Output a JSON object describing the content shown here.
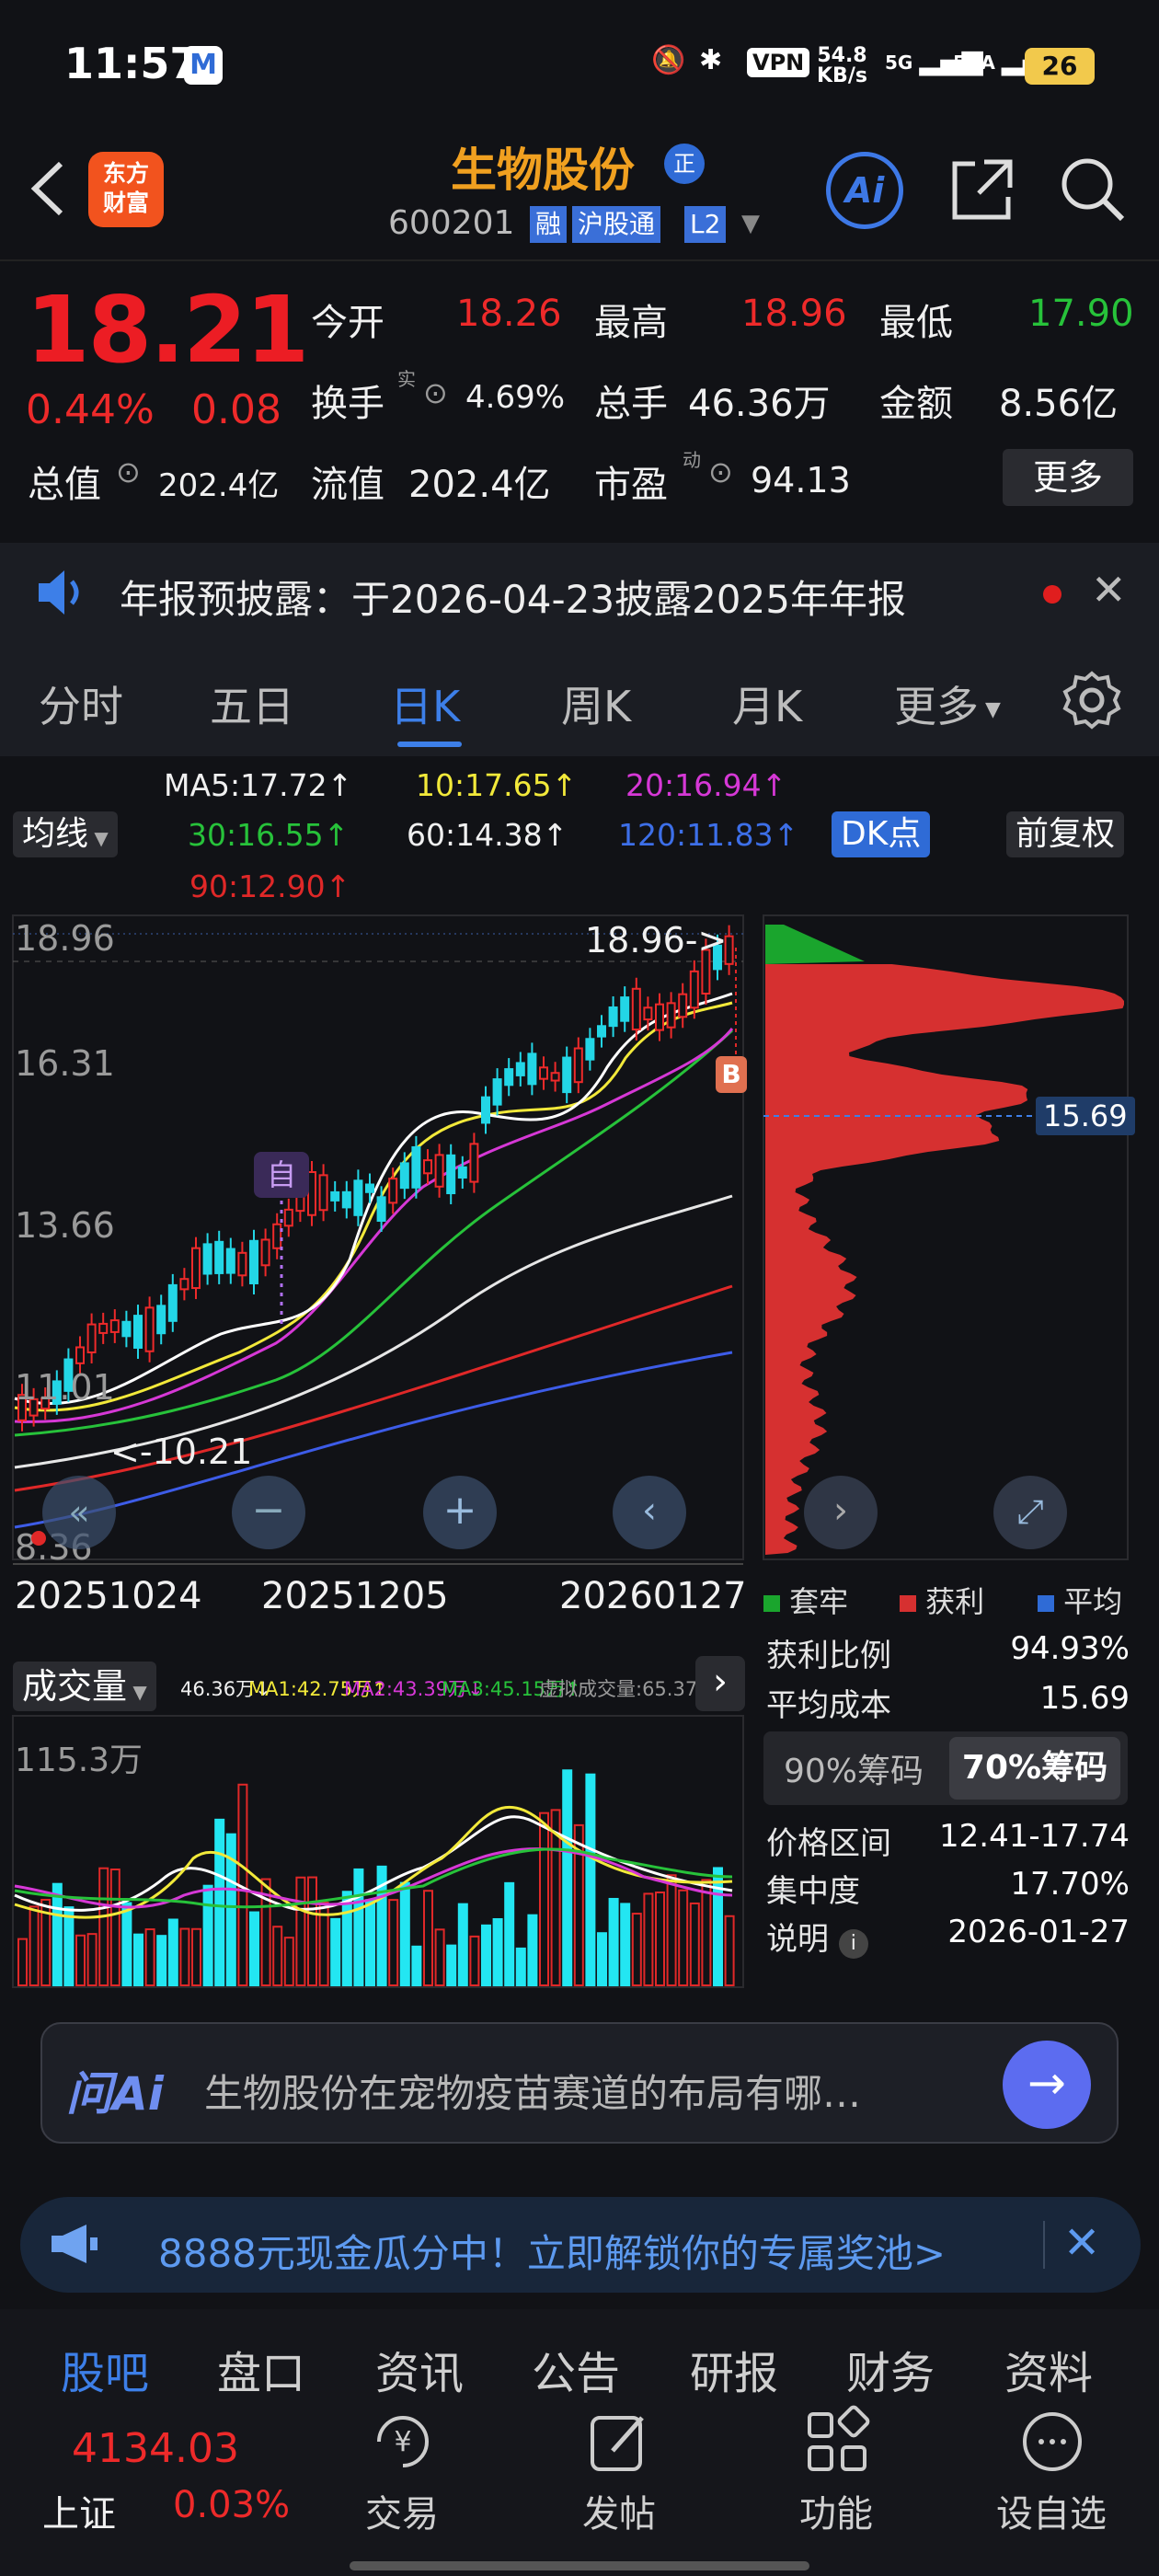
{
  "status_bar": {
    "time": "11:57",
    "net_speed": "54.8",
    "net_unit": "KB/s",
    "sig1": "5G",
    "sig2": "5GA",
    "battery": "26",
    "vpn": "VPN"
  },
  "header": {
    "logo_line1": "东方",
    "logo_line2": "财富",
    "stock_name": "生物股份",
    "badge": "正",
    "code": "600201",
    "tags": [
      "融",
      "沪股通",
      "L2"
    ],
    "ai_label": "Ai"
  },
  "quote": {
    "price": "18.21",
    "pct": "0.44%",
    "chg": "0.08",
    "open_label": "今开",
    "open": "18.26",
    "high_label": "最高",
    "high": "18.96",
    "low_label": "最低",
    "low": "17.90",
    "turnover_label": "换手",
    "turnover_sup": "实",
    "turnover": "4.69%",
    "vol_label": "总手",
    "vol": "46.36万",
    "amount_label": "金额",
    "amount": "8.56亿",
    "mcap_label": "总值",
    "mcap": "202.4亿",
    "float_label": "流值",
    "float": "202.4亿",
    "pe_label": "市盈",
    "pe_sup": "动",
    "pe": "94.13",
    "more": "更多"
  },
  "notice": {
    "text": "年报预披露：于2026-04-23披露2025年年报"
  },
  "tabs": [
    {
      "label": "分时"
    },
    {
      "label": "五日"
    },
    {
      "label": "日K"
    },
    {
      "label": "周K"
    },
    {
      "label": "月K"
    },
    {
      "label": "更多"
    }
  ],
  "ma": {
    "btn": "均线",
    "ma5": "MA5:17.72↑",
    "ma10": "10:17.65↑",
    "ma20": "20:16.94↑",
    "ma30": "30:16.55↑",
    "ma60": "60:14.38↑",
    "ma120": "120:11.83↑",
    "ma90": "90:12.90↑",
    "dk": "DK点",
    "fq": "前复权"
  },
  "kline": {
    "y_labels": [
      "18.96",
      "16.31",
      "13.66",
      "11.01",
      "8.36"
    ],
    "high_note": "18.96->",
    "low_note": "<-10.21",
    "self_mark": "自",
    "b_mark": "B",
    "dates": [
      "20251024",
      "20251205",
      "20260127"
    ]
  },
  "chip": {
    "avg_tag": "15.69",
    "legend": [
      "套牢",
      "获利",
      "平均"
    ],
    "legend_colors": [
      "#1aa52d",
      "#d63030",
      "#2f6bd6"
    ],
    "profit_label": "获利比例",
    "profit": "94.93%",
    "cost_label": "平均成本",
    "cost": "15.69",
    "tab90": "90%筹码",
    "tab70": "70%筹码",
    "range_label": "价格区间",
    "range": "12.41-17.74",
    "conc_label": "集中度",
    "conc": "17.70%",
    "note_label": "说明",
    "note": "2026-01-27"
  },
  "volume": {
    "btn": "成交量",
    "v": "46.36万↓",
    "ma1": "MA1:42.75万↑",
    "ma2": "MA2:43.39万↓",
    "ma3": "MA3:45.15万↑",
    "virt": "虚拟成交量:65.37万",
    "y_top": "115.3万"
  },
  "askai": {
    "label": "问Ai",
    "prompt": "生物股份在宠物疫苗赛道的布局有哪…"
  },
  "promo": {
    "text": "8888元现金瓜分中！立即解锁你的专属奖池>"
  },
  "bottom_tabs": [
    "股吧",
    "盘口",
    "资讯",
    "公告",
    "研报",
    "财务",
    "资料"
  ],
  "index": {
    "value": "4134.03",
    "name": "上证",
    "pct": "0.03%"
  },
  "bottom_nav": [
    {
      "label": "交易"
    },
    {
      "label": "发帖"
    },
    {
      "label": "功能"
    },
    {
      "label": "设自选"
    }
  ]
}
